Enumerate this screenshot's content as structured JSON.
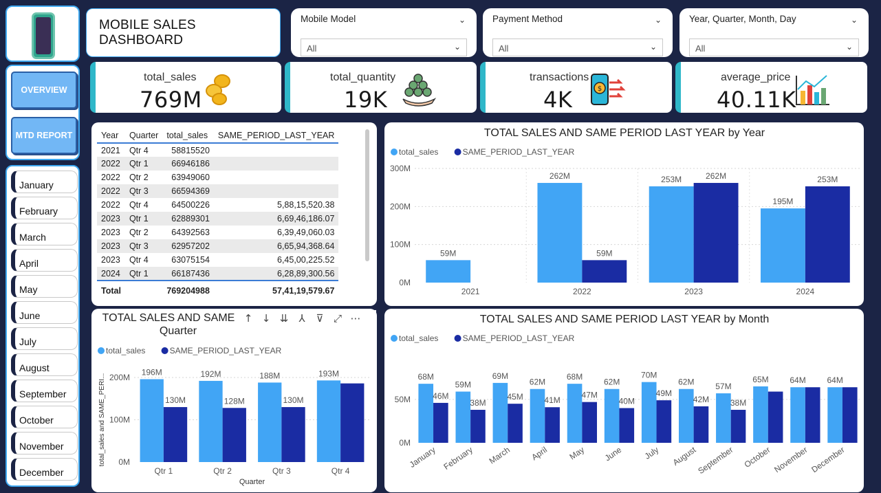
{
  "header": {
    "title": "MOBILE SALES DASHBOARD"
  },
  "slicers": [
    {
      "label": "Mobile Model",
      "value": "All"
    },
    {
      "label": "Payment Method",
      "value": "All"
    },
    {
      "label": "Year, Quarter, Month, Day",
      "value": "All"
    }
  ],
  "nav": {
    "overview_label": "OVERVIEW",
    "mtd_label": "MTD REPORT"
  },
  "months": [
    "January",
    "February",
    "March",
    "April",
    "May",
    "June",
    "July",
    "August",
    "September",
    "October",
    "November",
    "December"
  ],
  "kpis": [
    {
      "label": "total_sales",
      "value": "769M",
      "icon": "coins-icon"
    },
    {
      "label": "total_quantity",
      "value": "19K",
      "icon": "money-bag-icon"
    },
    {
      "label": "transactions",
      "value": "4K",
      "icon": "mobile-payment-icon"
    },
    {
      "label": "average_price",
      "value": "40.11K",
      "icon": "bar-chart-icon"
    }
  ],
  "table": {
    "headers": [
      "Year",
      "Quarter",
      "total_sales",
      "SAME_PERIOD_LAST_YEAR"
    ],
    "rows": [
      [
        "2021",
        "Qtr 4",
        "58815520",
        ""
      ],
      [
        "2022",
        "Qtr 1",
        "66946186",
        ""
      ],
      [
        "2022",
        "Qtr 2",
        "63949060",
        ""
      ],
      [
        "2022",
        "Qtr 3",
        "66594369",
        ""
      ],
      [
        "2022",
        "Qtr 4",
        "64500226",
        "5,88,15,520.38"
      ],
      [
        "2023",
        "Qtr 1",
        "62889301",
        "6,69,46,186.07"
      ],
      [
        "2023",
        "Qtr 2",
        "64392563",
        "6,39,49,060.03"
      ],
      [
        "2023",
        "Qtr 3",
        "62957202",
        "6,65,94,368.64"
      ],
      [
        "2023",
        "Qtr 4",
        "63075154",
        "6,45,00,225.52"
      ],
      [
        "2024",
        "Qtr 1",
        "66187436",
        "6,28,89,300.56"
      ]
    ],
    "total": [
      "Total",
      "",
      "769204988",
      "57,41,19,579.67"
    ]
  },
  "chart_data": [
    {
      "type": "bar",
      "title": "TOTAL SALES AND SAME PERIOD LAST YEAR by Year",
      "legend_position": "top-left",
      "categories": [
        "2021",
        "2022",
        "2023",
        "2024"
      ],
      "series": [
        {
          "name": "total_sales",
          "color": "#41a5f5",
          "values": [
            59,
            262,
            253,
            195
          ],
          "labels": [
            "59M",
            "262M",
            "253M",
            "195M"
          ]
        },
        {
          "name": "SAME_PERIOD_LAST_YEAR",
          "color": "#1a2ca3",
          "values": [
            null,
            59,
            262,
            253
          ],
          "labels": [
            "",
            "59M",
            "262M",
            "253M"
          ]
        }
      ],
      "ylim": [
        0,
        300
      ],
      "yticks": [
        "0M",
        "100M",
        "200M",
        "300M"
      ],
      "grid": true
    },
    {
      "type": "bar",
      "title": "TOTAL SALES AND SAME PERIOD LAST YEAR by Quarter",
      "title_visible": "TOTAL SALES AND SAME",
      "title_line2": "Quarter",
      "legend_position": "top-left",
      "xlabel": "Quarter",
      "ylabel": "total_sales and SAME_PERI...",
      "categories": [
        "Qtr 1",
        "Qtr 2",
        "Qtr 3",
        "Qtr 4"
      ],
      "series": [
        {
          "name": "total_sales",
          "color": "#41a5f5",
          "values": [
            196,
            192,
            188,
            193
          ],
          "labels": [
            "196M",
            "192M",
            "188M",
            "193M"
          ]
        },
        {
          "name": "SAME_PERIOD_LAST_YEAR",
          "color": "#1a2ca3",
          "values": [
            130,
            128,
            130,
            186
          ],
          "labels": [
            "130M",
            "128M",
            "130M",
            ""
          ]
        }
      ],
      "ylim": [
        0,
        200
      ],
      "yticks": [
        "0M",
        "100M",
        "200M"
      ],
      "grid": true
    },
    {
      "type": "bar",
      "title": "TOTAL SALES AND SAME PERIOD LAST YEAR by Month",
      "legend_position": "top-left",
      "categories": [
        "January",
        "February",
        "March",
        "April",
        "May",
        "June",
        "July",
        "August",
        "September",
        "October",
        "November",
        "December"
      ],
      "series": [
        {
          "name": "total_sales",
          "color": "#41a5f5",
          "values": [
            68,
            59,
            69,
            62,
            68,
            62,
            70,
            62,
            57,
            65,
            64,
            64
          ],
          "labels": [
            "68M",
            "59M",
            "69M",
            "62M",
            "68M",
            "62M",
            "70M",
            "62M",
            "57M",
            "65M",
            "64M",
            "64M"
          ]
        },
        {
          "name": "SAME_PERIOD_LAST_YEAR",
          "color": "#1a2ca3",
          "values": [
            46,
            38,
            45,
            41,
            47,
            40,
            49,
            42,
            38,
            59,
            64,
            64
          ],
          "labels": [
            "46M",
            "38M",
            "45M",
            "41M",
            "47M",
            "40M",
            "49M",
            "42M",
            "38M",
            "",
            "",
            ""
          ]
        }
      ],
      "ylim": [
        0,
        80
      ],
      "yticks": [
        "0M",
        "50M"
      ],
      "grid": true
    }
  ]
}
